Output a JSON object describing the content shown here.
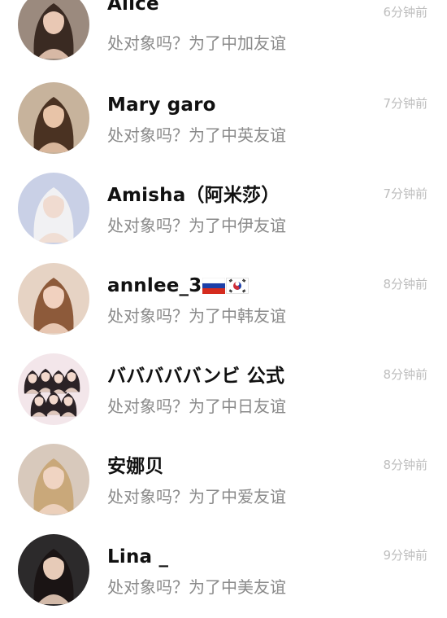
{
  "conversations": [
    {
      "name": "Alice",
      "message": "处对象吗？为了中加友谊",
      "time": "6分钟前",
      "avatar": "woman-avatar-icon",
      "bg": "#9b8a7e",
      "hair": "#3a2a22",
      "skin": "#e9c8b4"
    },
    {
      "name": "Mary garo",
      "message": "处对象吗？为了中英友谊",
      "time": "7分钟前",
      "avatar": "woman-avatar-icon",
      "bg": "#c7b39c",
      "hair": "#4a3222",
      "skin": "#e8c4a8"
    },
    {
      "name": "Amisha（阿米莎）",
      "message": "处对象吗？为了中伊友谊",
      "time": "7分钟前",
      "avatar": "woman-avatar-icon",
      "bg": "#c9d0e6",
      "hair": "#f1f1f3",
      "skin": "#f0dbd0"
    },
    {
      "name": "annlee_3",
      "message": "处对象吗？为了中韩友谊",
      "time": "8分钟前",
      "avatar": "woman-avatar-icon",
      "flags": [
        "russia-flag-icon",
        "korea-flag-icon"
      ],
      "bg": "#e6d3c4",
      "hair": "#8d5a3a",
      "skin": "#f1d1bf"
    },
    {
      "name": "バババババンビ 公式",
      "message": "处对象吗？为了中日友谊",
      "time": "8分钟前",
      "avatar": "group-avatar-icon",
      "bg": "#f3e6ea",
      "hair": "#2b2226",
      "skin": "#f2d8cc"
    },
    {
      "name": "安娜贝",
      "message": "处对象吗？为了中爱友谊",
      "time": "8分钟前",
      "avatar": "woman-avatar-icon",
      "bg": "#d8c9bc",
      "hair": "#c9a87a",
      "skin": "#f0d4c2"
    },
    {
      "name": "Lina _",
      "message": "处对象吗？为了中美友谊",
      "time": "9分钟前",
      "avatar": "woman-avatar-icon",
      "bg": "#2c2a2b",
      "hair": "#1a1414",
      "skin": "#e7cbb8"
    }
  ]
}
